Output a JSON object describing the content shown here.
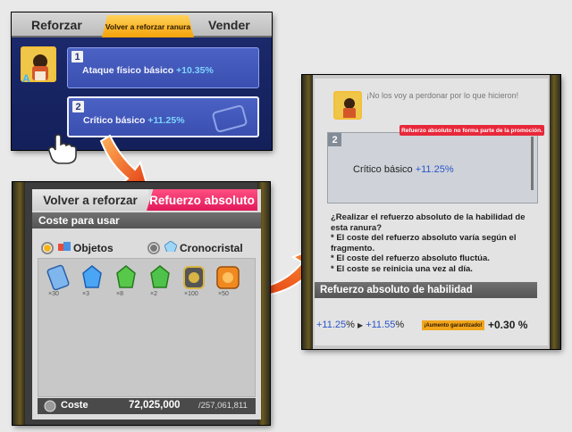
{
  "panel1": {
    "tabs": {
      "left": "Reforzar",
      "center": "Volver a reforzar ranura",
      "right": "Vender"
    },
    "slots": [
      {
        "num": "1",
        "label": "Ataque físico básico",
        "value": "+10.35",
        "unit": "%"
      },
      {
        "num": "2",
        "label": "Crítico básico",
        "value": "+11.25",
        "unit": "%"
      }
    ]
  },
  "panel2": {
    "tab_volver": "Volver a reforzar",
    "tab_refuerzo": "Refuerzo absoluto",
    "coste_header": "Coste para usar",
    "option_objetos": "Objetos",
    "option_cronocristal": "Cronocristal",
    "items": [
      {
        "count": "×30",
        "color": "#6aa8e8"
      },
      {
        "count": "×3",
        "color": "#3f9cf0"
      },
      {
        "count": "×8",
        "color": "#4cc24a"
      },
      {
        "count": "×2",
        "color": "#47c64a"
      },
      {
        "count": "×100",
        "color": "#c8a83a"
      },
      {
        "count": "×50",
        "color": "#f08a20"
      }
    ],
    "cost_label": "Coste",
    "cost_value": "72,025,000",
    "cost_total": "/257,061,811"
  },
  "panel3": {
    "quote": "¡No los voy a perdonar por lo que hicieron!",
    "warning": "Refuerzo absoluto no forma parte de la promoción.",
    "slot_num": "2",
    "slot_label": "Crítico básico",
    "slot_value": "+11.25",
    "slot_unit": "%",
    "question": "¿Realizar el refuerzo absoluto de la habilidad de esta ranura?",
    "bullet1": "* El coste del refuerzo absoluto varía según el fragmento.",
    "bullet2": "* El coste del refuerzo absoluto fluctúa.",
    "bullet3": "* El coste se reinicia una vez al día.",
    "header": "Refuerzo absoluto de habilidad",
    "pct_from": "+11.25",
    "pct_to": "+11.55",
    "pct_unit": "%",
    "badge": "¡Aumento garantizado!",
    "plus": "+0.30 %"
  }
}
